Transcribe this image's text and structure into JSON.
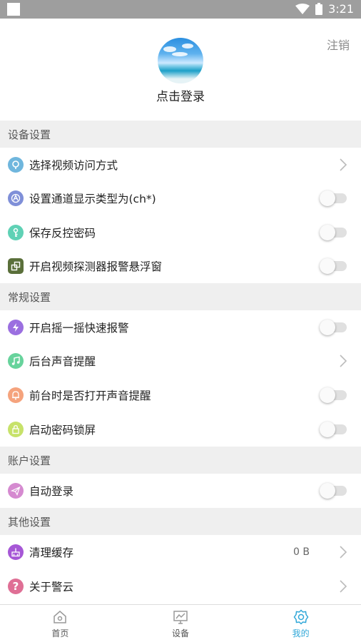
{
  "status_bar": {
    "time": "3:21",
    "icons": [
      "notification-icon",
      "wifi-icon",
      "battery-icon"
    ]
  },
  "profile": {
    "logout_label": "注销",
    "login_label": "点击登录"
  },
  "sections": {
    "device": {
      "title": "设备设置",
      "items": [
        {
          "label": "选择视频访问方式",
          "control": "chevron",
          "icon": "video-access-icon",
          "color": "#6fb6dd"
        },
        {
          "label": "设置通道显示类型为(ch*)",
          "control": "toggle",
          "on": false,
          "icon": "channel-type-icon",
          "color": "#7f8fd8"
        },
        {
          "label": "保存反控密码",
          "control": "toggle",
          "on": false,
          "icon": "key-icon",
          "color": "#5fd1b5"
        },
        {
          "label": "开启视频探测器报警悬浮窗",
          "control": "toggle",
          "on": false,
          "icon": "floating-window-icon",
          "color": "#5a6f3a"
        }
      ]
    },
    "general": {
      "title": "常规设置",
      "items": [
        {
          "label": "开启摇一摇快速报警",
          "control": "toggle",
          "on": false,
          "icon": "lightning-icon",
          "color": "#9b6fe0"
        },
        {
          "label": "后台声音提醒",
          "control": "chevron",
          "icon": "music-note-icon",
          "color": "#67d39c"
        },
        {
          "label": "前台时是否打开声音提醒",
          "control": "toggle",
          "on": false,
          "icon": "bell-icon",
          "color": "#f5a37d"
        },
        {
          "label": "启动密码锁屏",
          "control": "toggle",
          "on": false,
          "icon": "lock-icon",
          "color": "#c7e26a"
        }
      ]
    },
    "account": {
      "title": "账户设置",
      "items": [
        {
          "label": "自动登录",
          "control": "toggle",
          "on": false,
          "icon": "send-icon",
          "color": "#d58ad0"
        }
      ]
    },
    "other": {
      "title": "其他设置",
      "items": [
        {
          "label": "清理缓存",
          "control": "chevron",
          "value": "0 B",
          "icon": "clean-cache-icon",
          "color": "#a657d6"
        },
        {
          "label": "关于警云",
          "control": "chevron",
          "icon": "question-icon",
          "color": "#df6f95"
        }
      ]
    }
  },
  "tabbar": {
    "tabs": [
      {
        "label": "首页",
        "icon": "home-icon",
        "active": false
      },
      {
        "label": "设备",
        "icon": "device-icon",
        "active": false
      },
      {
        "label": "我的",
        "icon": "gear-icon",
        "active": true
      }
    ],
    "active_color": "#2fa7d8"
  }
}
